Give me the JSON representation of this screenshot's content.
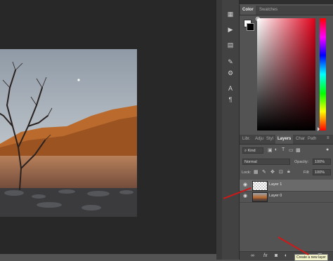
{
  "colors": {
    "accent": "#d01818",
    "panel": "#535353",
    "canvas_bg": "#282828",
    "hue_top": "#ff0000"
  },
  "panels": {
    "color_tabs": [
      "Color",
      "Swatches"
    ],
    "layers_tabs": [
      "Libr.",
      "Adju",
      "Styl",
      "Layers",
      "Char",
      "Path"
    ],
    "kind_label": "Kind",
    "blend_mode": "Normal",
    "opacity_label": "Opacity:",
    "opacity_value": "100%",
    "lock_label": "Lock:",
    "fill_label": "Fill:",
    "fill_value": "100%",
    "layers": [
      {
        "name": "Layer 1",
        "selected": true
      },
      {
        "name": "Layer 0",
        "selected": false
      }
    ]
  },
  "tooltip": "Create a new layer",
  "icons": [
    "history-icon",
    "actions-icon",
    "properties-icon",
    "adjustments-icon",
    "character-icon",
    "paragraph-icon"
  ]
}
